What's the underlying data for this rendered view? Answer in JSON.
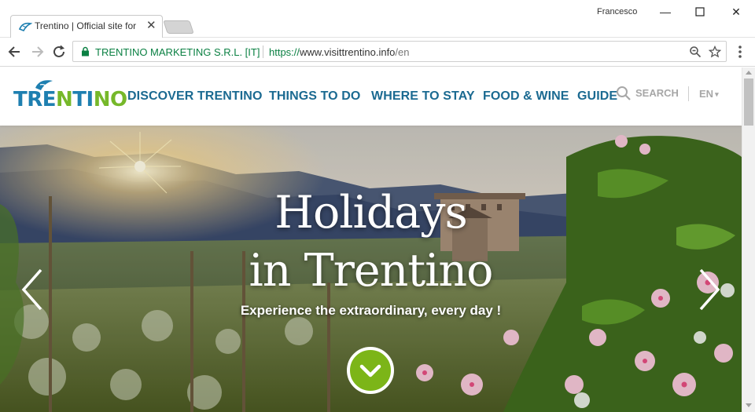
{
  "browser": {
    "tab_title": "Trentino | Official site for",
    "user_name": "Francesco",
    "cert_name": "TRENTINO MARKETING S.R.L. [IT]",
    "url_scheme": "https://",
    "url_host": "www.visittrentino.info",
    "url_path": "/en",
    "icons": [
      "back-arrow-icon",
      "forward-arrow-icon",
      "reload-icon",
      "lock-icon",
      "zoom-icon",
      "star-icon",
      "menu-dots-icon"
    ]
  },
  "site": {
    "logo_text": "TRENTINO",
    "logo_colors": [
      "#1e7fb0",
      "#76b82a"
    ],
    "nav": [
      {
        "label": "DISCOVER TRENTINO"
      },
      {
        "label": "THINGS TO DO"
      },
      {
        "label": "WHERE TO STAY"
      },
      {
        "label": "FOOD & WINE"
      },
      {
        "label": "GUIDE"
      }
    ],
    "search_label": "SEARCH",
    "language": "EN",
    "nav_color": "#1b6a91"
  },
  "hero": {
    "title_line1": "Holidays",
    "title_line2": "in Trentino",
    "subtitle": "Experience the extraordinary, every day !",
    "button_color": "#7cb518"
  }
}
